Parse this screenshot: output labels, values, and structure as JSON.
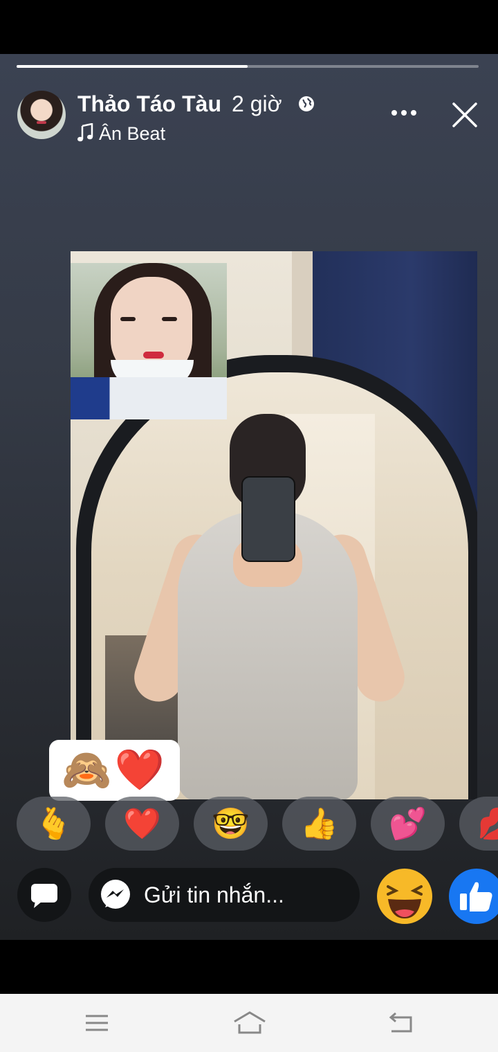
{
  "story": {
    "progress_fraction": 0.5,
    "author": "Thảo Táo Tàu",
    "time": "2 giờ",
    "music": "Ân Beat",
    "privacy_icon": "globe-icon",
    "music_icon": "music-note-icon"
  },
  "sticker": {
    "emojis": [
      "🙈",
      "❤️"
    ]
  },
  "reactions": [
    {
      "emoji": "🫰"
    },
    {
      "emoji": "❤️"
    },
    {
      "emoji": "🤓"
    },
    {
      "emoji": "👍"
    },
    {
      "emoji": "💕"
    },
    {
      "emoji": "💋"
    }
  ],
  "composer": {
    "placeholder": "Gửi tin nhắn..."
  },
  "colors": {
    "like_blue": "#1877f2",
    "haha_yellow": "#f7b928",
    "nav_bg": "#f4f4f4"
  }
}
